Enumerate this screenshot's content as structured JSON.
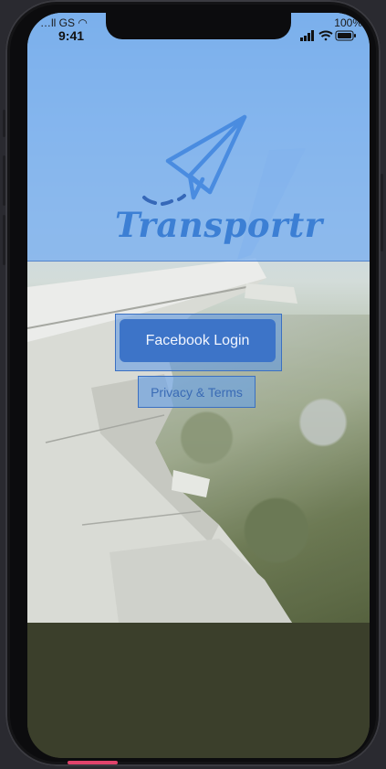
{
  "status_bar": {
    "carrier": "…ll GS ◠",
    "time": "9:41",
    "battery_pct": "100%"
  },
  "brand": {
    "name": "Transportr",
    "logo_icon": "paper-plane-icon",
    "color": "#3c7fd4"
  },
  "actions": {
    "facebook_label": "Facebook Login",
    "terms_label": "Privacy & Terms"
  },
  "colors": {
    "header_overlay": "#7ab0f0",
    "button_primary": "#3d74c8",
    "bottom_background": "#3b3f2b",
    "home_indicator": "#e0436b"
  }
}
